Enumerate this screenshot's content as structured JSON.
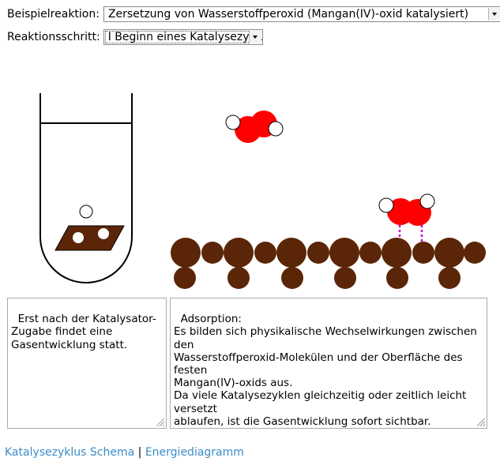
{
  "controls": {
    "reaction_label": "Beispielreaktion:",
    "reaction_value": "Zersetzung von Wasserstoffperoxid (Mangan(IV)-oxid katalysiert)",
    "step_label": "Reaktionsschritt:",
    "step_value": "I Beginn eines Katalysezyklus"
  },
  "text_left": "Erst nach der Katalysator-\nZugabe findet eine\nGasentwicklung statt.",
  "text_right": "Adsorption:\nEs bilden sich physikalische Wechselwirkungen zwischen den\nWasserstoffperoxid-Molekülen und der Oberfläche des festen\nMangan(IV)-oxids aus.\nDa viele Katalysezyklen gleichzeitig oder zeitlich leicht versetzt\nablaufen, ist die Gasentwicklung sofort sichtbar.",
  "links": {
    "schema": "Katalysezyklus Schema",
    "separator": "|",
    "energy": "Energiediagramm"
  },
  "colors": {
    "oxygen": "#ff0000",
    "hydrogen": "#ffffff",
    "catalyst": "#5a2607",
    "bond": "#cc00cc",
    "link": "#3c8cc8"
  }
}
